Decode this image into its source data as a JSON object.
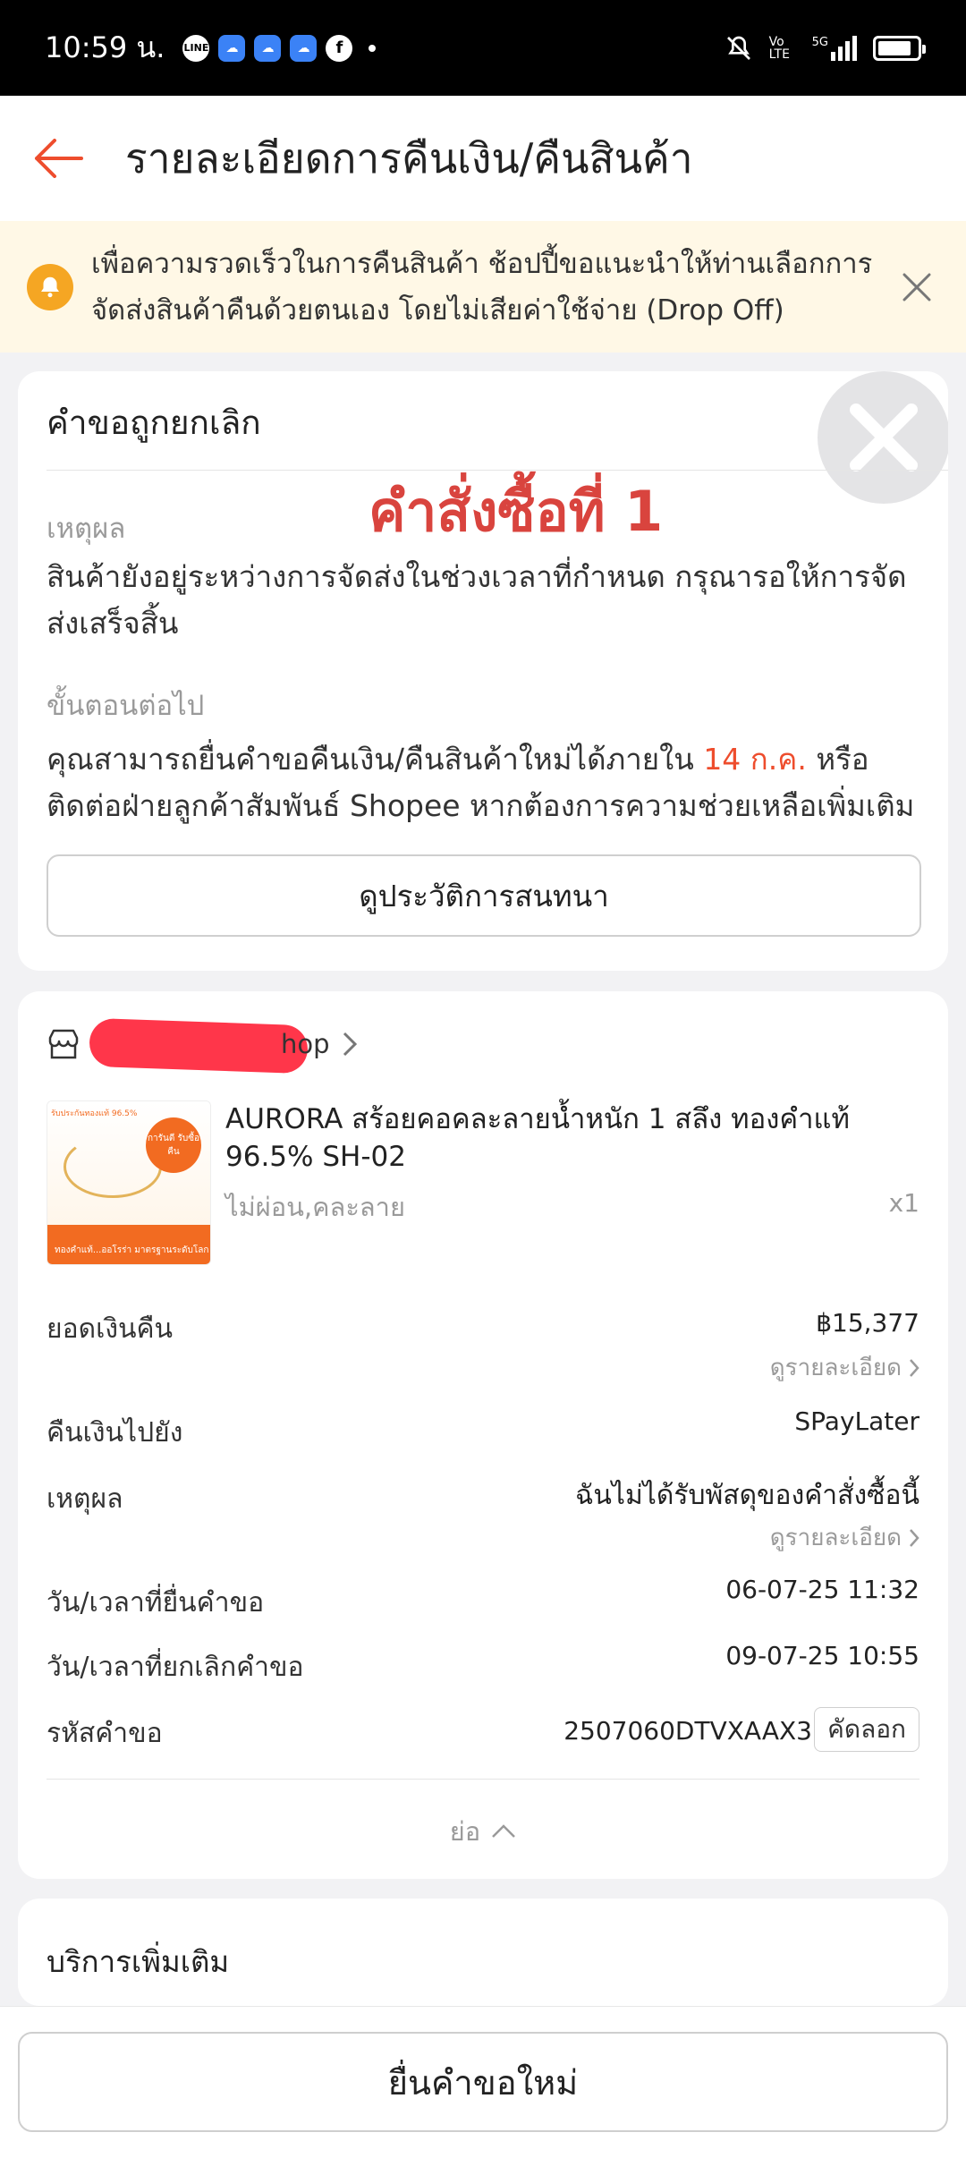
{
  "status_bar": {
    "time": "10:59 น.",
    "network": "5G",
    "volte": "Vo LTE",
    "battery_level": 0.85
  },
  "header": {
    "title": "รายละเอียดการคืนเงิน/คืนสินค้า"
  },
  "banner": {
    "text": "เพื่อความรวดเร็วในการคืนสินค้า ช้อปปี้ขอแนะนำให้ท่านเลือกการจัดส่งสินค้าคืนด้วยตนเอง โดยไม่เสียค่าใช้จ่าย (Drop Off)"
  },
  "request_status": {
    "title": "คำขอถูกยกเลิก",
    "overlay_label": "คำสั่งซื้อที่ 1",
    "reason_label": "เหตุผล",
    "reason_text": "สินค้ายังอยู่ระหว่างการจัดส่งในช่วงเวลาที่กำหนด กรุณารอให้การจัดส่งเสร็จสิ้น",
    "next_label": "ขั้นตอนต่อไป",
    "next_text_before": "คุณสามารถยื่นคำขอคืนเงิน/คืนสินค้าใหม่ได้ภายใน ",
    "next_date": "14 ก.ค.",
    "next_text_after": " หรือติดต่อฝ่ายลูกค้าสัมพันธ์ Shopee หากต้องการความช่วยเหลือเพิ่มเติม",
    "chat_button": "ดูประวัติการสนทนา"
  },
  "order": {
    "shop_name": "hop",
    "product_name": "AURORA สร้อยคอคละลายน้ำหนัก 1 สลึง ทองคำแท้ 96.5% SH-02",
    "variant": "ไม่ผ่อน,คละลาย",
    "quantity": "x1",
    "image_texts": {
      "top": "รับประกันทองแท้ 96.5%",
      "badge": "การันตี รับซื้อคืน",
      "bottom": "ทองคำแท้...ออโรร่า มาตรฐานระดับโลก"
    },
    "refund_amount_label": "ยอดเงินคืน",
    "refund_amount": "฿15,377",
    "detail_link": "ดูรายละเอียด",
    "refund_to_label": "คืนเงินไปยัง",
    "refund_to": "SPayLater",
    "reason_label": "เหตุผล",
    "reason": "ฉันไม่ได้รับพัสดุของคำสั่งซื้อนี้",
    "submitted_label": "วัน/เวลาที่ยื่นคำขอ",
    "submitted_at": "06-07-25 11:32",
    "cancelled_label": "วัน/เวลาที่ยกเลิกคำขอ",
    "cancelled_at": "09-07-25 10:55",
    "request_id_label": "รหัสคำขอ",
    "request_id": "2507060DTVXAAX3",
    "copy_button": "คัดลอก",
    "collapse_label": "ย่อ"
  },
  "services": {
    "title": "บริการเพิ่มเติม"
  },
  "bottom_bar": {
    "new_request_button": "ยื่นคำขอใหม่"
  },
  "colors": {
    "accent": "#ee4d2d",
    "overlay_red": "#d9443e",
    "banner_bg": "#fff8e6",
    "bell": "#f5a623"
  }
}
